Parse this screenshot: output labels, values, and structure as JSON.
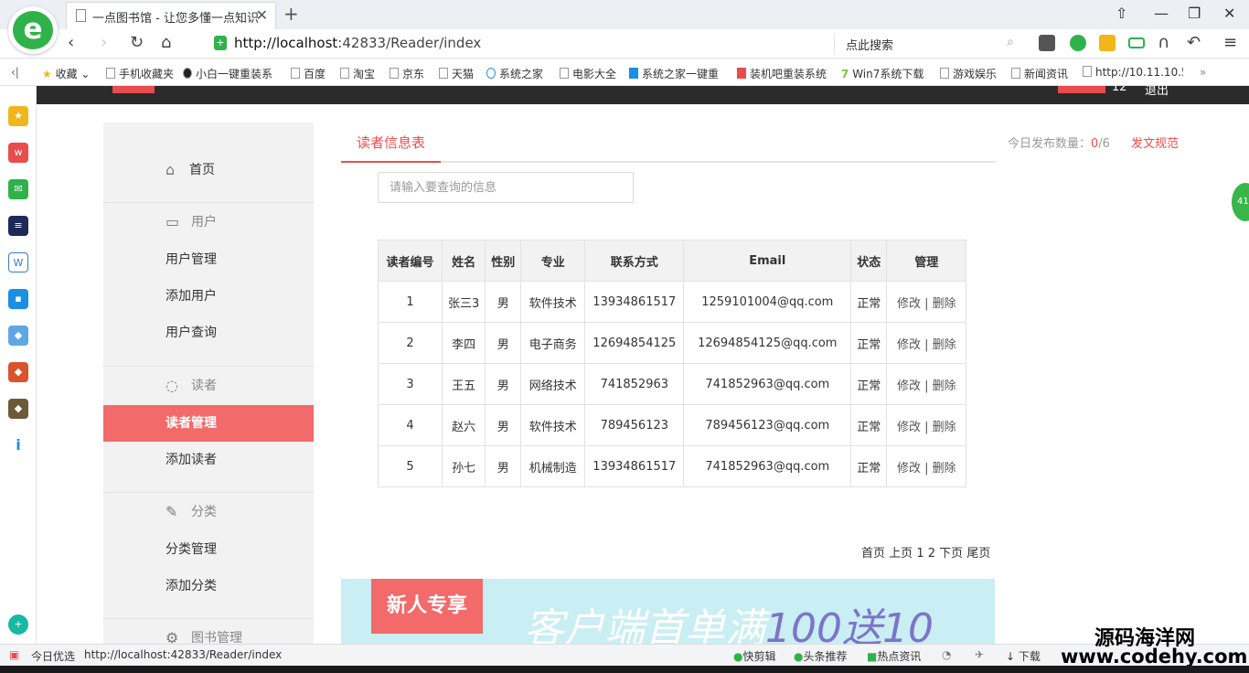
{
  "browser": {
    "tab_title": "一点图书馆 - 让您多懂一点知识",
    "url_host": "http://localhost",
    "url_rest": ":42833/Reader/index",
    "search_label": "点此搜索",
    "bookmarks": [
      "收藏",
      "手机收藏夹",
      "小白一键重装系",
      "百度",
      "淘宝",
      "京东",
      "天猫",
      "系统之家",
      "电影大全",
      "系统之家一键重",
      "装机吧重装系统",
      "Win7系统下载",
      "游戏娱乐",
      "新闻资讯",
      "http://10.11.10.5"
    ],
    "status_url": "http://localhost:42833/Reader/index",
    "status_left": "今日优选",
    "status_items": [
      "快剪辑",
      "头条推荐",
      "热点资讯",
      "下载"
    ]
  },
  "header": {
    "count": "12",
    "logout": "退出"
  },
  "menu": {
    "home": "首页",
    "groups": [
      {
        "label": "用户",
        "items": [
          "用户管理",
          "添加用户",
          "用户查询"
        ]
      },
      {
        "label": "读者",
        "items": [
          "读者管理",
          "添加读者"
        ]
      },
      {
        "label": "分类",
        "items": [
          "分类管理",
          "添加分类"
        ]
      },
      {
        "label": "图书管理",
        "items": []
      }
    ]
  },
  "main": {
    "tab": "读者信息表",
    "quota_label": "今日发布数量：",
    "quota_value": "0",
    "quota_total": "/6",
    "rule_link": "发文规范",
    "search_placeholder": "请输入要查询的信息",
    "columns": [
      "读者编号",
      "姓名",
      "性别",
      "专业",
      "联系方式",
      "Email",
      "状态",
      "管理"
    ],
    "rows": [
      [
        "1",
        "张三3",
        "男",
        "软件技术",
        "13934861517",
        "1259101004@qq.com",
        "正常"
      ],
      [
        "2",
        "李四",
        "男",
        "电子商务",
        "12694854125",
        "12694854125@qq.com",
        "正常"
      ],
      [
        "3",
        "王五",
        "男",
        "网络技术",
        "741852963",
        "741852963@qq.com",
        "正常"
      ],
      [
        "4",
        "赵六",
        "男",
        "软件技术",
        "789456123",
        "789456123@qq.com",
        "正常"
      ],
      [
        "5",
        "孙七",
        "男",
        "机械制造",
        "13934861517",
        "741852963@qq.com",
        "正常"
      ]
    ],
    "edit": "修改",
    "delete": "删除",
    "pager": {
      "first": "首页",
      "prev": "上页",
      "pages": [
        "1",
        "2"
      ],
      "next": "下页",
      "last": "尾页"
    },
    "banner": {
      "tag": "新人专享",
      "text": "客户端首单满",
      "number": "100送10"
    }
  },
  "watermark": {
    "line1": "源码海洋网",
    "line2": "www.codehy.com"
  },
  "colors": {
    "accent": "#f04c4c",
    "menu_active": "#f26a6a",
    "brand_green": "#2fb24a"
  }
}
